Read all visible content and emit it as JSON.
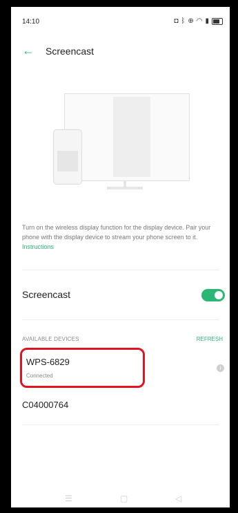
{
  "status_bar": {
    "time": "14:10",
    "icons": [
      "nfc-icon",
      "bluetooth-icon",
      "hotspot-icon",
      "wifi-icon",
      "signal-icon",
      "battery-icon"
    ]
  },
  "header": {
    "title": "Screencast"
  },
  "description": {
    "text": "Turn on the wireless display function for the display device. Pair your phone with the display device to stream your phone screen to it.",
    "link": "Instructions"
  },
  "screencast_toggle": {
    "label": "Screencast",
    "state": "on"
  },
  "devices": {
    "section_label": "AVAILABLE DEVICES",
    "refresh_label": "REFRESH",
    "items": [
      {
        "name": "WPS-6829",
        "status": "Connected"
      },
      {
        "name": "C04000764"
      }
    ]
  },
  "nav_bar": {
    "icons": [
      "menu-icon",
      "home-icon",
      "back-icon"
    ]
  },
  "colors": {
    "accent": "#2bb673",
    "highlight": "#e0141e"
  }
}
